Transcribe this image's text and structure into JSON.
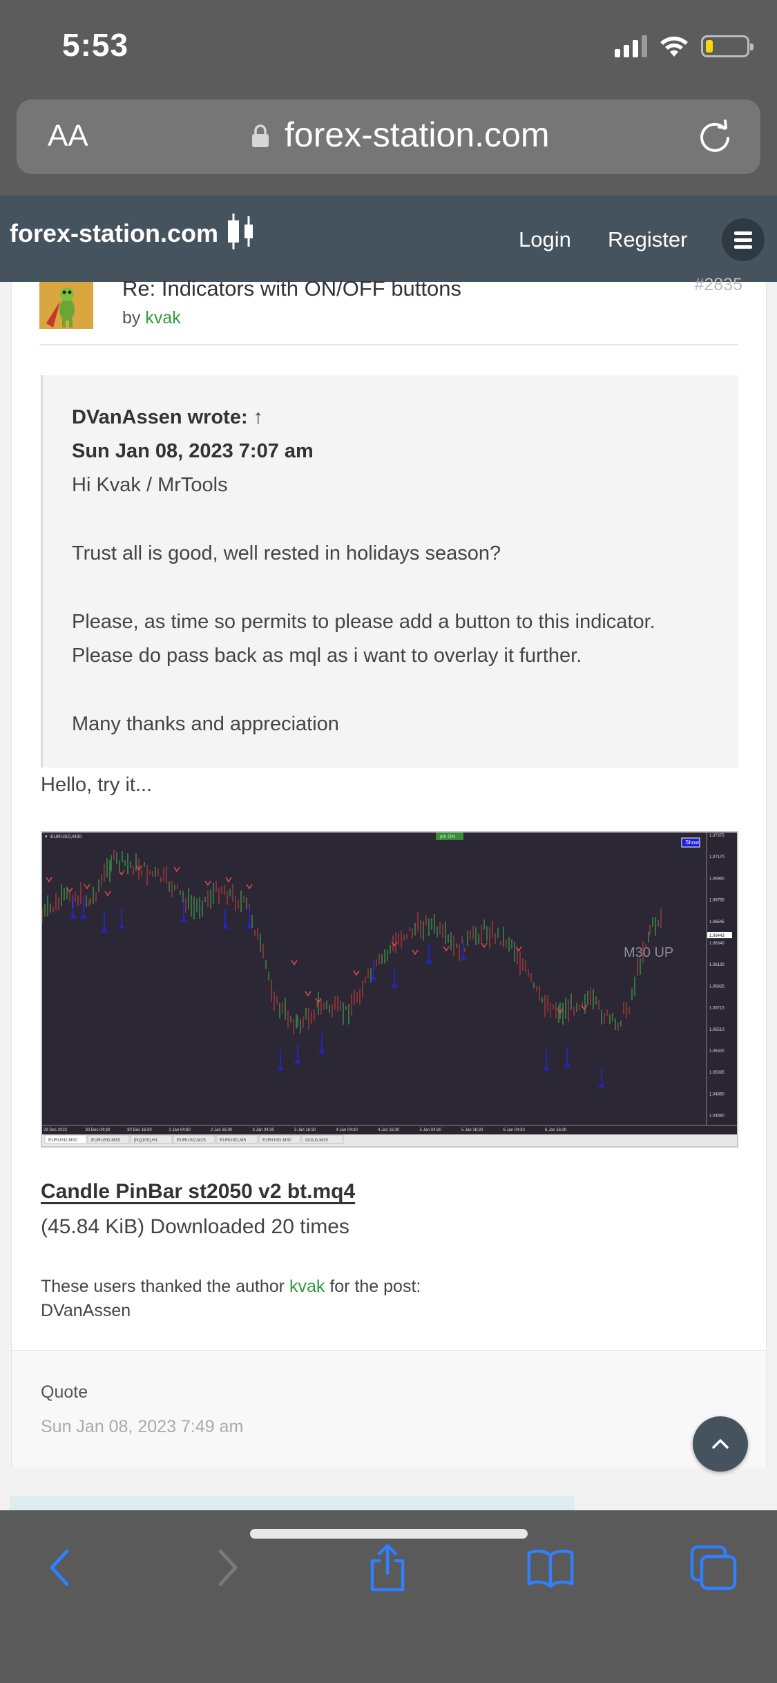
{
  "status": {
    "time": "5:53"
  },
  "browser": {
    "aa_label": "AA",
    "url": "forex-station.com"
  },
  "header": {
    "logo": "forex-station.com",
    "login": "Login",
    "register": "Register"
  },
  "post": {
    "title": "Re: Indicators with ON/OFF buttons",
    "by_prefix": "by",
    "author": "kvak",
    "number": "#2835",
    "quote": {
      "author_line": "DVanAssen wrote: ↑",
      "date": "Sun Jan 08, 2023 7:07 am",
      "lines": [
        "Hi Kvak / MrTools",
        "Trust all is good, well rested in holidays season?",
        "Please, as time so permits to please add a button to this indicator.",
        "Please do pass back as mql as i want to overlay it further.",
        "Many thanks and appreciation"
      ]
    },
    "reply": "Hello, try it...",
    "attachment": {
      "name": "Candle PinBar st2050 v2 bt.mq4",
      "info": "(45.84 KiB) Downloaded 20 times"
    },
    "thanks": {
      "prefix": "These users thanked the author",
      "author": "kvak",
      "suffix": "for the post:",
      "users": "DVanAssen"
    },
    "footer": {
      "quote_label": "Quote",
      "date": "Sun Jan 08, 2023 7:49 am"
    }
  },
  "chart_screenshot": {
    "symbol": "EURUSD,M30",
    "toggle_label": "pin ON",
    "show_button": "Show",
    "overlay_text": "M30 UP",
    "price_labels": [
      "1.07375",
      "1.07170",
      "1.06960",
      "1.06755",
      "1.06545",
      "1.06340",
      "1.06130",
      "1.05925",
      "1.05715",
      "1.05510",
      "1.05300",
      "1.05095",
      "1.04890",
      "1.04680"
    ],
    "current_price": "1.06443",
    "time_labels": [
      "29 Dec 2022",
      "30 Dec 04:30",
      "30 Dec 16:30",
      "2 Jan 04:30",
      "2 Jan 16:30",
      "3 Jan 04:30",
      "3 Jan 16:30",
      "4 Jan 04:30",
      "4 Jan 16:30",
      "5 Jan 04:30",
      "5 Jan 16:30",
      "6 Jan 04:30",
      "6 Jan 16:30"
    ],
    "tabs": [
      "EURUSD,M30",
      "EURUSD,M15",
      "[NQ100],H1",
      "EURUSD,M15",
      "EURUSD,M5",
      "EURUSD,M30",
      "GOLD,M15"
    ]
  }
}
